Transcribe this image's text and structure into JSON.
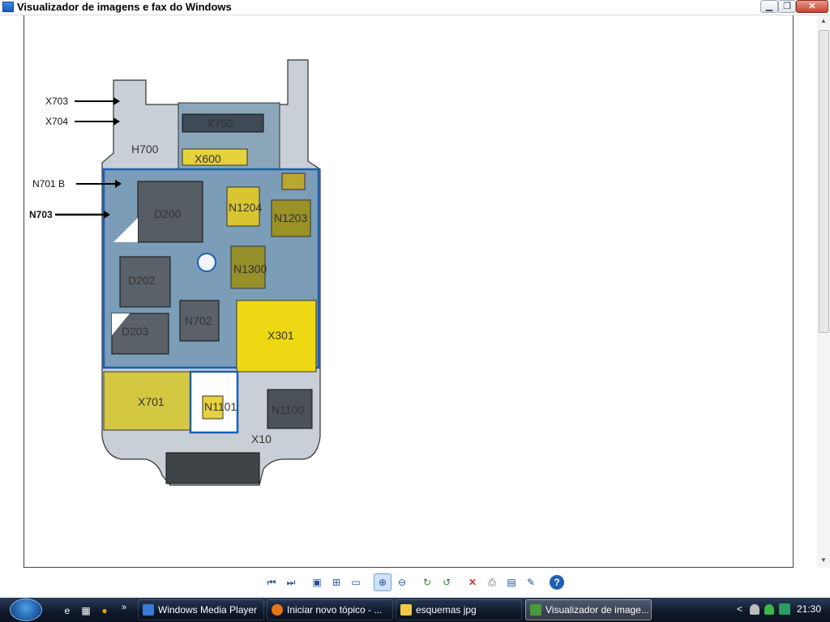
{
  "window": {
    "title": "Visualizador de imagens e fax do Windows",
    "min_symbol": "▁",
    "max_symbol": "❐",
    "close_symbol": "✕"
  },
  "image": {
    "callouts": [
      "X703",
      "X704",
      "N701  B",
      "N703"
    ],
    "components": [
      "X750",
      "H700",
      "X600",
      "D200",
      "D202",
      "D203",
      "N702",
      "N1204",
      "N1203",
      "N1300",
      "X301",
      "X701",
      "N1100",
      "N1101",
      "X10"
    ]
  },
  "toolbar": {
    "buttons": [
      {
        "name": "previous-image-button",
        "glyph": "⏮"
      },
      {
        "name": "next-image-button",
        "glyph": "⏭"
      },
      {
        "name": "best-fit-button",
        "glyph": "▣"
      },
      {
        "name": "actual-size-button",
        "glyph": "⊞"
      },
      {
        "name": "slideshow-button",
        "glyph": "▭"
      },
      {
        "name": "zoom-in-button",
        "glyph": "⊕"
      },
      {
        "name": "zoom-out-button",
        "glyph": "⊖"
      },
      {
        "name": "rotate-clockwise-button",
        "glyph": "↻"
      },
      {
        "name": "rotate-counterclockwise-button",
        "glyph": "↺"
      },
      {
        "name": "delete-button",
        "glyph": "✕"
      },
      {
        "name": "print-button",
        "glyph": "⎙"
      },
      {
        "name": "save-button",
        "glyph": "▤"
      },
      {
        "name": "edit-button",
        "glyph": "✎"
      },
      {
        "name": "help-button",
        "glyph": "?"
      }
    ]
  },
  "taskbar": {
    "tasks": [
      {
        "label": "Windows Media Player",
        "color": "#3a7bd5"
      },
      {
        "label": "Iniciar novo tópico - ...",
        "color": "#e8751a"
      },
      {
        "label": "esquemas jpg",
        "color": "#f1c84b"
      },
      {
        "label": "Visualizador de image...",
        "color": "#4a9a3a"
      }
    ],
    "chevron": "»",
    "clock": "21:30",
    "tray_chevron": "<"
  }
}
